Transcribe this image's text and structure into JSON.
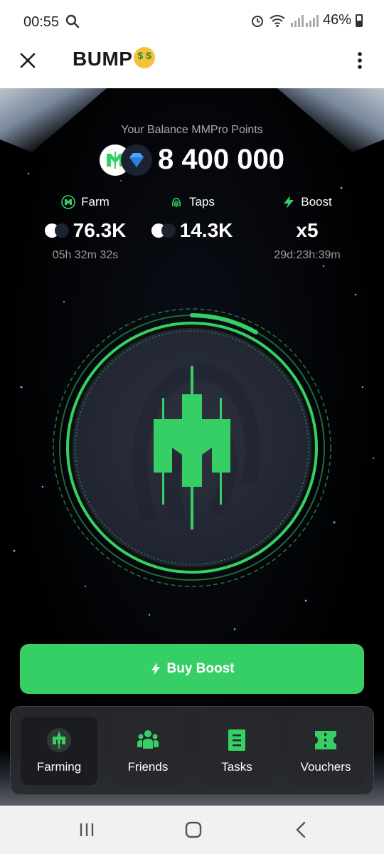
{
  "status": {
    "time": "00:55",
    "battery": "46%"
  },
  "app": {
    "title": "BUMP"
  },
  "balance": {
    "label": "Your Balance MMPro Points",
    "value": "8 400 000"
  },
  "stats": {
    "farm": {
      "label": "Farm",
      "value": "76.3K",
      "timer": "05h 32m 32s"
    },
    "taps": {
      "label": "Taps",
      "value": "14.3K"
    },
    "boost": {
      "label": "Boost",
      "value": "x5",
      "timer": "29d:23h:39m"
    }
  },
  "colors": {
    "accent": "#36cf66",
    "background": "#000000"
  },
  "buy_button": {
    "label": "Buy Boost"
  },
  "nav": {
    "items": [
      {
        "label": "Farming",
        "icon": "mm-logo-icon"
      },
      {
        "label": "Friends",
        "icon": "friends-icon"
      },
      {
        "label": "Tasks",
        "icon": "tasks-icon"
      },
      {
        "label": "Vouchers",
        "icon": "voucher-icon"
      }
    ]
  }
}
